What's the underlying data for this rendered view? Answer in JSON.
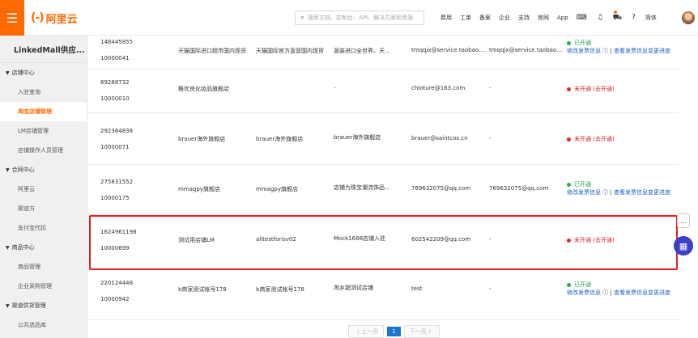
{
  "topbar": {
    "logo_mark": "(-)",
    "logo_text": "阿里云",
    "search_placeholder": "搜索文档、控制台、API、解决方案和资源",
    "nav": [
      "费用",
      "工单",
      "备案",
      "企业",
      "支持",
      "官网",
      "App"
    ],
    "lang": "简体"
  },
  "sidebar": {
    "title": "LinkedMall供应...",
    "groups": [
      {
        "label": "店铺中心",
        "items": [
          "入驻查询",
          "淘宝店铺管理",
          "LM店铺管理",
          "店铺操作人员管理"
        ]
      },
      {
        "label": "合同中心",
        "items": [
          "阿里云",
          "渠道方",
          "支付宝代扣"
        ]
      },
      {
        "label": "商品中心",
        "items": [
          "商品管理",
          "企业采购管理"
        ]
      },
      {
        "label": "渠道供货管理",
        "items": [
          "公共选品库"
        ]
      }
    ],
    "active": "淘宝店铺管理"
  },
  "rows": [
    {
      "id1": "148445855",
      "id2": "10000041",
      "name": "天猫国际进口超市国内现货",
      "alias": "天猫国际官方直营国内现货",
      "desc": "源装进口全世界。天...",
      "email1": "tmqqjx@service.taobao.com",
      "email2": "tmqqjx@service.taobao.com",
      "status": "已开通",
      "status_type": "open",
      "link1": "修改发票信息",
      "link2": "查看发票信息变更进度"
    },
    {
      "id1": "69288732",
      "id2": "10000010",
      "name": "稚优良化妆品旗舰店",
      "alias": "",
      "desc": "-",
      "email1": "chioture@163.com",
      "email2": "-",
      "status": "未开通",
      "status_type": "closed",
      "open_link": "(去开通)"
    },
    {
      "id1": "292364838",
      "id2": "10000071",
      "name": "brauer海外旗舰店",
      "alias": "brauer海外旗舰店",
      "desc": "brauer海外旗舰店",
      "email1": "brauer@saintcos.cn",
      "email2": "-",
      "status": "未开通",
      "status_type": "closed",
      "open_link": "(去开通)"
    },
    {
      "id1": "275831552",
      "id2": "10000175",
      "name": "mmagpy旗舰店",
      "alias": "mmagpy旗舰店",
      "desc": "店铺为珠宝潮流饰品...",
      "email1": "769632075@qq.com",
      "email2": "769632075@qq.com",
      "status": "已开通",
      "status_type": "open",
      "link1": "修改发票信息",
      "link2": "查看发票信息变更进度"
    },
    {
      "id1": "1624961198",
      "id2": "10000699",
      "name": "测试用店铺LM",
      "alias": "alitestforisv02",
      "desc": "Mock1688店铺入驻",
      "email1": "602542209@qq.com",
      "email2": "-",
      "status": "未开通",
      "status_type": "closed",
      "open_link": "(去开通)"
    },
    {
      "id1": "220124448",
      "id2": "10000942",
      "name": "b商家测试帐号178",
      "alias": "b商家测试帐号178",
      "desc": "淘乡甜测试店铺",
      "email1": "test",
      "email2": "-",
      "status": "已开通",
      "status_type": "open",
      "link1": "修改发票信息",
      "link2": "查看发票信息变更进度"
    }
  ],
  "pager": {
    "prev": "上一页",
    "current": "1",
    "next": "下一页"
  }
}
